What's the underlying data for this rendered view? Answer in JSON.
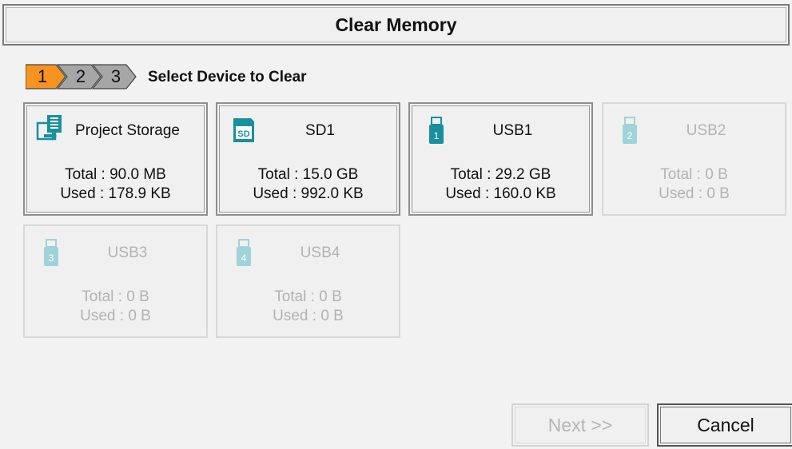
{
  "window": {
    "title": "Clear Memory"
  },
  "wizard": {
    "steps": [
      "1",
      "2",
      "3"
    ],
    "active_step": 1,
    "step_title": "Select Device to Clear"
  },
  "devices": [
    {
      "name": "Project Storage",
      "icon": "project-storage-icon",
      "total": "Total : 90.0 MB",
      "used": "Used : 178.9 KB",
      "enabled": true
    },
    {
      "name": "SD1",
      "icon": "sd-card-icon",
      "total": "Total : 15.0 GB",
      "used": "Used : 992.0 KB",
      "enabled": true
    },
    {
      "name": "USB1",
      "icon": "usb-drive-icon",
      "badge": "1",
      "total": "Total : 29.2 GB",
      "used": "Used : 160.0 KB",
      "enabled": true
    },
    {
      "name": "USB2",
      "icon": "usb-drive-icon",
      "badge": "2",
      "total": "Total : 0 B",
      "used": "Used : 0 B",
      "enabled": false
    },
    {
      "name": "USB3",
      "icon": "usb-drive-icon",
      "badge": "3",
      "total": "Total : 0 B",
      "used": "Used : 0 B",
      "enabled": false
    },
    {
      "name": "USB4",
      "icon": "usb-drive-icon",
      "badge": "4",
      "total": "Total : 0 B",
      "used": "Used : 0 B",
      "enabled": false
    }
  ],
  "buttons": {
    "next": "Next >>",
    "cancel": "Cancel"
  },
  "colors": {
    "active_step": "#f7931e",
    "inactive_step": "#a6a6a6",
    "icon_teal": "#1a8f9e",
    "icon_teal_disabled": "#9fd3d9"
  }
}
